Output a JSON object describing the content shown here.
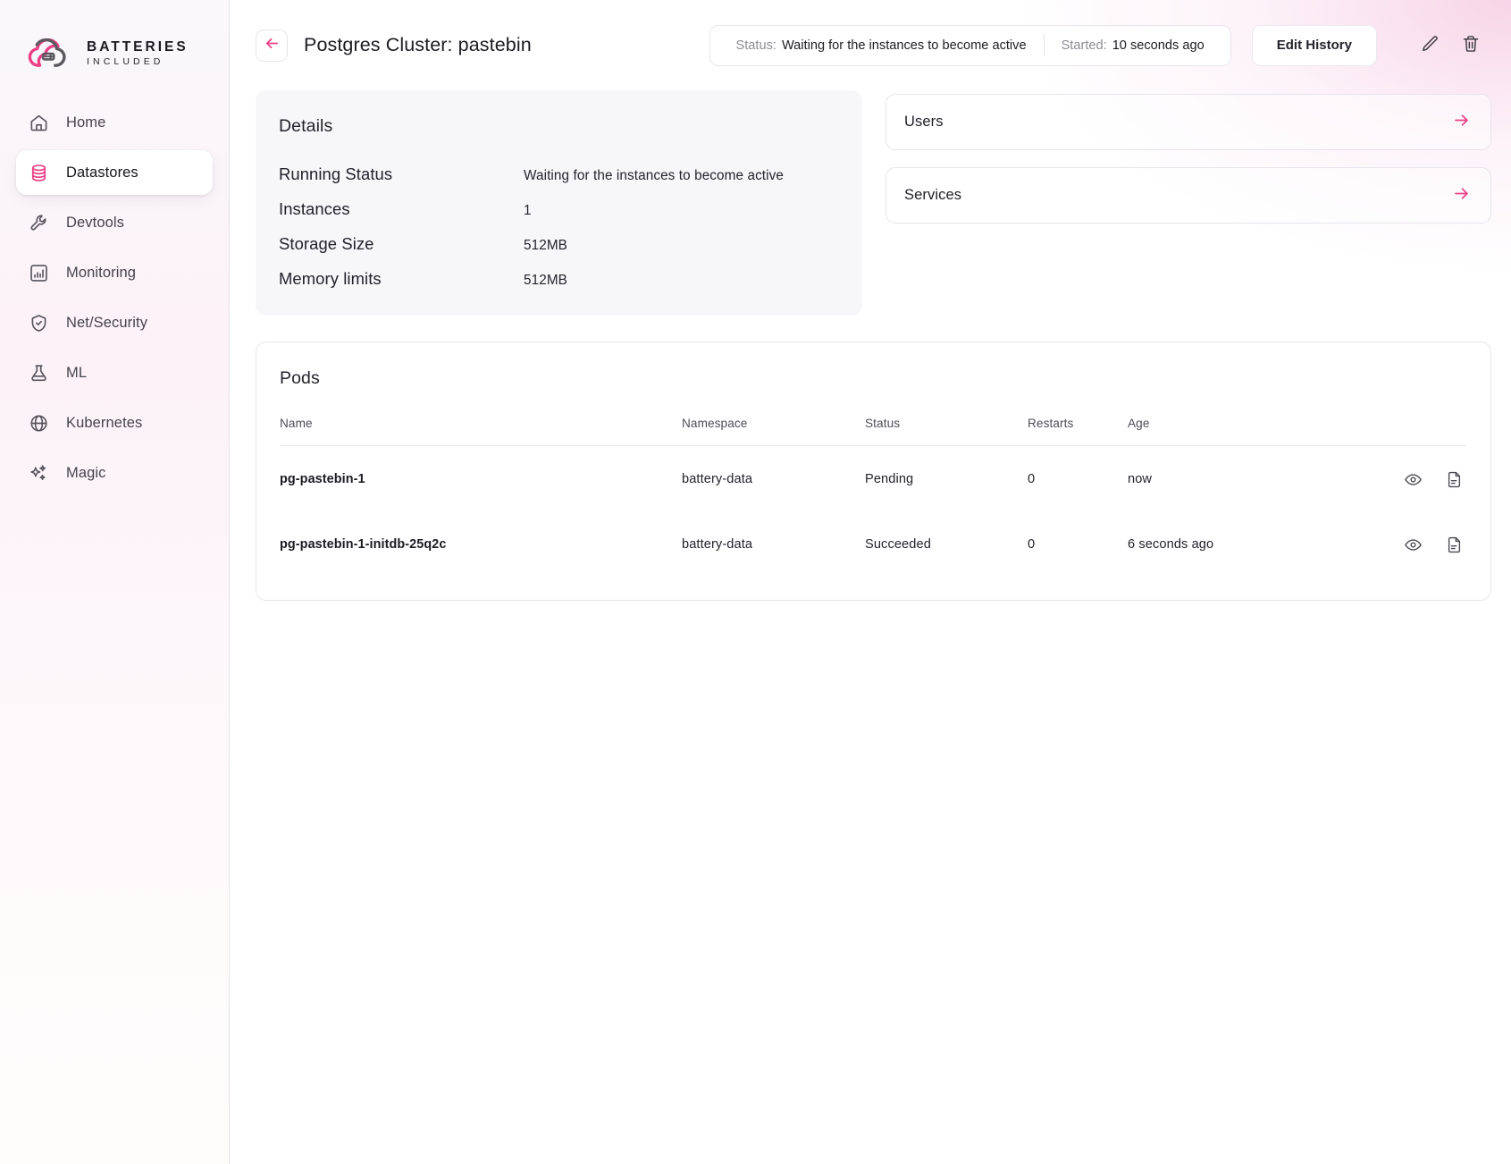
{
  "brand": {
    "title": "BATTERIES",
    "subtitle": "INCLUDED",
    "accent": "#ec3f86",
    "logo_icon": "cloud-battery-logo"
  },
  "sidebar": {
    "items": [
      {
        "label": "Home",
        "icon": "home-icon",
        "active": false
      },
      {
        "label": "Datastores",
        "icon": "database-icon",
        "active": true
      },
      {
        "label": "Devtools",
        "icon": "wrench-icon",
        "active": false
      },
      {
        "label": "Monitoring",
        "icon": "chart-bars-icon",
        "active": false
      },
      {
        "label": "Net/Security",
        "icon": "shield-check-icon",
        "active": false
      },
      {
        "label": "ML",
        "icon": "flask-icon",
        "active": false
      },
      {
        "label": "Kubernetes",
        "icon": "globe-icon",
        "active": false
      },
      {
        "label": "Magic",
        "icon": "sparkles-icon",
        "active": false
      }
    ]
  },
  "header": {
    "back_icon": "arrow-left-icon",
    "title": "Postgres Cluster: pastebin",
    "status_label": "Status:",
    "status_value": "Waiting for the instances to become active",
    "started_label": "Started:",
    "started_value": "10 seconds ago",
    "edit_history_label": "Edit History",
    "edit_icon": "pencil-icon",
    "delete_icon": "trash-icon"
  },
  "details": {
    "heading": "Details",
    "rows": [
      {
        "key": "Running Status",
        "value": "Waiting for the instances to become active"
      },
      {
        "key": "Instances",
        "value": "1"
      },
      {
        "key": "Storage Size",
        "value": "512MB"
      },
      {
        "key": "Memory limits",
        "value": "512MB"
      }
    ]
  },
  "link_cards": [
    {
      "label": "Users",
      "icon": "arrow-right-icon"
    },
    {
      "label": "Services",
      "icon": "arrow-right-icon"
    }
  ],
  "pods": {
    "heading": "Pods",
    "columns": [
      "Name",
      "Namespace",
      "Status",
      "Restarts",
      "Age"
    ],
    "rows": [
      {
        "name": "pg-pastebin-1",
        "namespace": "battery-data",
        "status": "Pending",
        "restarts": "0",
        "age": "now",
        "actions": [
          "eye-icon",
          "document-icon"
        ]
      },
      {
        "name": "pg-pastebin-1-initdb-25q2c",
        "namespace": "battery-data",
        "status": "Succeeded",
        "restarts": "0",
        "age": "6 seconds ago",
        "actions": [
          "eye-icon",
          "document-icon"
        ]
      }
    ]
  }
}
